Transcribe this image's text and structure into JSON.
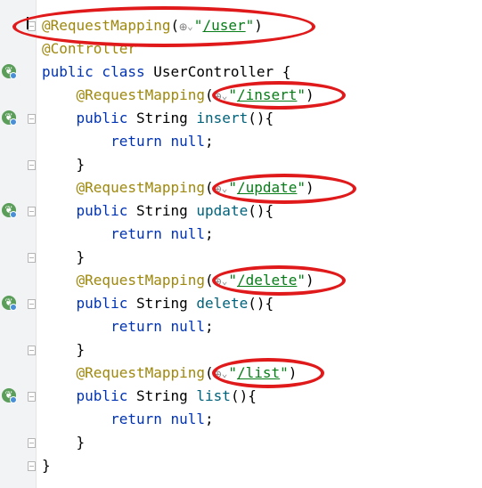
{
  "editor": {
    "lines": [
      {
        "tokens": [
          {
            "cls": "ann",
            "text": "@RequestMapping"
          },
          {
            "cls": "punct",
            "text": "("
          },
          {
            "cls": "glyph glyph-web",
            "text": "⊕"
          },
          {
            "cls": "glyph glyph-chev",
            "text": "⌄"
          },
          {
            "cls": "str",
            "text": "\""
          },
          {
            "cls": "url",
            "text": "/user"
          },
          {
            "cls": "str",
            "text": "\""
          },
          {
            "cls": "punct",
            "text": ")"
          }
        ]
      },
      {
        "tokens": [
          {
            "cls": "ann",
            "text": "@Controller"
          }
        ]
      },
      {
        "tokens": [
          {
            "cls": "kw",
            "text": "public class "
          },
          {
            "cls": "punct",
            "text": "UserController {"
          }
        ]
      },
      {
        "tokens": [
          {
            "cls": "punct",
            "text": "    "
          },
          {
            "cls": "ann",
            "text": "@RequestMapping"
          },
          {
            "cls": "punct",
            "text": "("
          },
          {
            "cls": "glyph glyph-web",
            "text": "⊕"
          },
          {
            "cls": "glyph glyph-chev",
            "text": "⌄"
          },
          {
            "cls": "str",
            "text": "\""
          },
          {
            "cls": "url",
            "text": "/insert"
          },
          {
            "cls": "str",
            "text": "\""
          },
          {
            "cls": "punct",
            "text": ")"
          }
        ]
      },
      {
        "tokens": [
          {
            "cls": "punct",
            "text": "    "
          },
          {
            "cls": "kw",
            "text": "public "
          },
          {
            "cls": "punct",
            "text": "String "
          },
          {
            "cls": "fn",
            "text": "insert"
          },
          {
            "cls": "punct",
            "text": "(){"
          }
        ]
      },
      {
        "tokens": [
          {
            "cls": "punct",
            "text": "        "
          },
          {
            "cls": "kw",
            "text": "return null"
          },
          {
            "cls": "punct",
            "text": ";"
          }
        ]
      },
      {
        "tokens": [
          {
            "cls": "punct",
            "text": "    }"
          }
        ]
      },
      {
        "tokens": [
          {
            "cls": "punct",
            "text": "    "
          },
          {
            "cls": "ann",
            "text": "@RequestMapping"
          },
          {
            "cls": "punct",
            "text": "("
          },
          {
            "cls": "glyph glyph-web",
            "text": "⊕"
          },
          {
            "cls": "glyph glyph-chev",
            "text": "⌄"
          },
          {
            "cls": "str",
            "text": "\""
          },
          {
            "cls": "url",
            "text": "/update"
          },
          {
            "cls": "str",
            "text": "\""
          },
          {
            "cls": "punct",
            "text": ")"
          }
        ]
      },
      {
        "tokens": [
          {
            "cls": "punct",
            "text": "    "
          },
          {
            "cls": "kw",
            "text": "public "
          },
          {
            "cls": "punct",
            "text": "String "
          },
          {
            "cls": "fn",
            "text": "update"
          },
          {
            "cls": "punct",
            "text": "(){"
          }
        ]
      },
      {
        "tokens": [
          {
            "cls": "punct",
            "text": "        "
          },
          {
            "cls": "kw",
            "text": "return null"
          },
          {
            "cls": "punct",
            "text": ";"
          }
        ]
      },
      {
        "tokens": [
          {
            "cls": "punct",
            "text": "    }"
          }
        ]
      },
      {
        "tokens": [
          {
            "cls": "punct",
            "text": "    "
          },
          {
            "cls": "ann",
            "text": "@RequestMapping"
          },
          {
            "cls": "punct",
            "text": "("
          },
          {
            "cls": "glyph glyph-web",
            "text": "⊕"
          },
          {
            "cls": "glyph glyph-chev",
            "text": "⌄"
          },
          {
            "cls": "str",
            "text": "\""
          },
          {
            "cls": "url",
            "text": "/delete"
          },
          {
            "cls": "str",
            "text": "\""
          },
          {
            "cls": "punct",
            "text": ")"
          }
        ]
      },
      {
        "tokens": [
          {
            "cls": "punct",
            "text": "    "
          },
          {
            "cls": "kw",
            "text": "public "
          },
          {
            "cls": "punct",
            "text": "String "
          },
          {
            "cls": "fn",
            "text": "delete"
          },
          {
            "cls": "punct",
            "text": "(){"
          }
        ]
      },
      {
        "tokens": [
          {
            "cls": "punct",
            "text": "        "
          },
          {
            "cls": "kw",
            "text": "return null"
          },
          {
            "cls": "punct",
            "text": ";"
          }
        ]
      },
      {
        "tokens": [
          {
            "cls": "punct",
            "text": "    }"
          }
        ]
      },
      {
        "tokens": [
          {
            "cls": "punct",
            "text": "    "
          },
          {
            "cls": "ann",
            "text": "@RequestMapping"
          },
          {
            "cls": "punct",
            "text": "("
          },
          {
            "cls": "glyph glyph-web",
            "text": "⊕"
          },
          {
            "cls": "glyph glyph-chev",
            "text": "⌄"
          },
          {
            "cls": "str",
            "text": "\""
          },
          {
            "cls": "url",
            "text": "/list"
          },
          {
            "cls": "str",
            "text": "\""
          },
          {
            "cls": "punct",
            "text": ")"
          }
        ]
      },
      {
        "tokens": [
          {
            "cls": "punct",
            "text": "    "
          },
          {
            "cls": "kw",
            "text": "public "
          },
          {
            "cls": "punct",
            "text": "String "
          },
          {
            "cls": "fn",
            "text": "list"
          },
          {
            "cls": "punct",
            "text": "(){"
          }
        ]
      },
      {
        "tokens": [
          {
            "cls": "punct",
            "text": "        "
          },
          {
            "cls": "kw",
            "text": "return null"
          },
          {
            "cls": "punct",
            "text": ";"
          }
        ]
      },
      {
        "tokens": [
          {
            "cls": "punct",
            "text": "    }"
          }
        ]
      },
      {
        "tokens": [
          {
            "cls": "punct",
            "text": "}"
          }
        ]
      }
    ]
  },
  "gutter": {
    "run_icon": "spring-bean-icon",
    "fold_icon": "fold-marker-icon"
  },
  "annotations": {
    "highlight_color": "#e0191b"
  },
  "colors": {
    "annotation": "#9e880d",
    "keyword": "#0033b3",
    "method": "#00627a",
    "string": "#067d17",
    "gutter_bg": "#f2f3f5"
  }
}
